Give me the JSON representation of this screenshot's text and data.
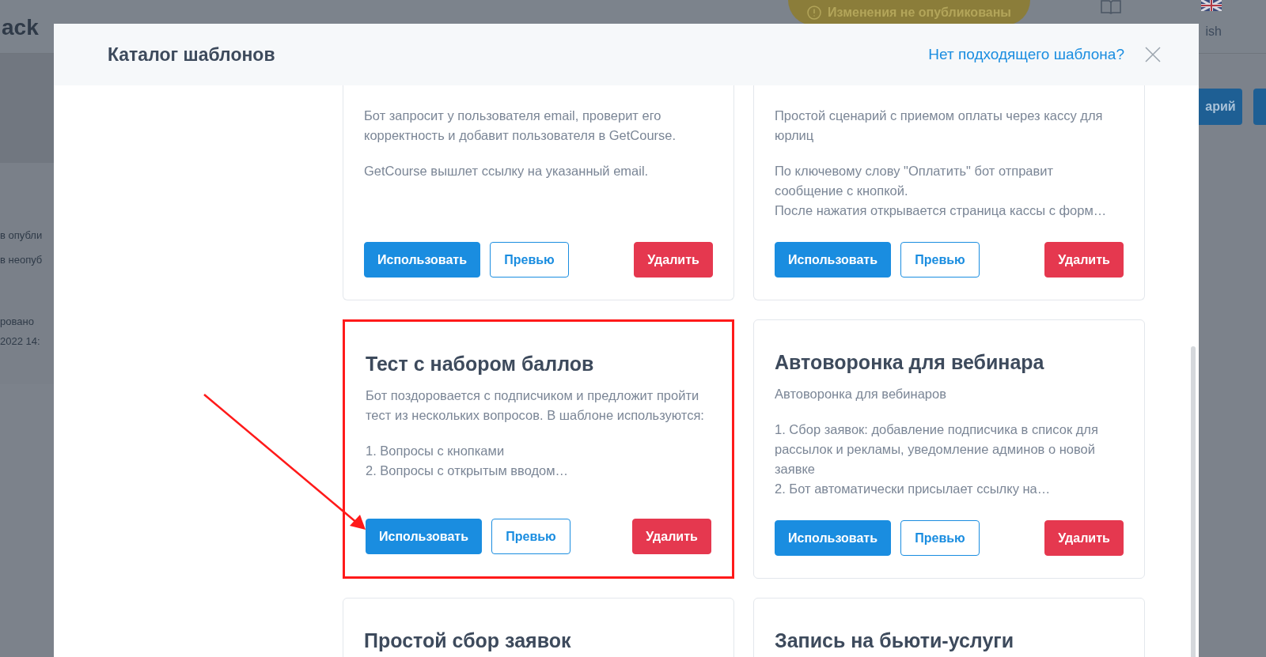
{
  "background": {
    "logo_text": "ack",
    "notice": "Изменения не опубликованы",
    "language": "ish",
    "action_button": "арий",
    "status_lines": [
      "в опубли",
      "в неопуб"
    ],
    "date_lines": [
      "ровано",
      "2022 14:"
    ]
  },
  "modal": {
    "title": "Каталог шаблонов",
    "help_link": "Нет подходящего шаблона?"
  },
  "templates": [
    {
      "highlighted": false,
      "blocks": [
        [
          "Бот запросит у пользователя email, проверит его корректность и добавит пользователя в GetCourse."
        ],
        [
          "GetCourse вышлет ссылку на указанный email."
        ]
      ],
      "buttons": [
        {
          "label": "Использовать",
          "kind": "primary"
        },
        {
          "label": "Превью",
          "kind": "outline"
        },
        {
          "label": "Удалить",
          "kind": "danger"
        }
      ]
    },
    {
      "highlighted": false,
      "blocks": [
        [
          "Простой сценарий с приемом оплаты через кассу для юрлиц"
        ],
        [
          "По ключевому слову \"Оплатить\" бот отправит сообщение с кнопкой.",
          "После нажатия открывается страница кассы с форм…"
        ]
      ],
      "buttons": [
        {
          "label": "Использовать",
          "kind": "primary"
        },
        {
          "label": "Превью",
          "kind": "outline"
        },
        {
          "label": "Удалить",
          "kind": "danger"
        }
      ]
    },
    {
      "title": "Тест с набором баллов",
      "highlighted": true,
      "blocks": [
        [
          "Бот поздоровается с подписчиком и предложит пройти тест из нескольких вопросов. В шаблоне используются:"
        ],
        [
          "1. Вопросы с кнопками",
          "2. Вопросы с открытым вводом…"
        ]
      ],
      "buttons": [
        {
          "label": "Использовать",
          "kind": "primary"
        },
        {
          "label": "Превью",
          "kind": "outline"
        },
        {
          "label": "Удалить",
          "kind": "danger"
        }
      ]
    },
    {
      "title": "Автоворонка для вебинара",
      "highlighted": false,
      "blocks": [
        [
          "Автоворонка для вебинаров"
        ],
        [
          "1. Сбор заявок: добавление подписчика в список для рассылок и рекламы, уведомление админов о новой заявке",
          "2. Бот автоматически присылает ссылку на…"
        ]
      ],
      "buttons": [
        {
          "label": "Использовать",
          "kind": "primary"
        },
        {
          "label": "Превью",
          "kind": "outline"
        },
        {
          "label": "Удалить",
          "kind": "danger"
        }
      ]
    },
    {
      "title": "Простой сбор заявок",
      "highlighted": false
    },
    {
      "title": "Запись на бьюти-услуги",
      "highlighted": false
    }
  ]
}
